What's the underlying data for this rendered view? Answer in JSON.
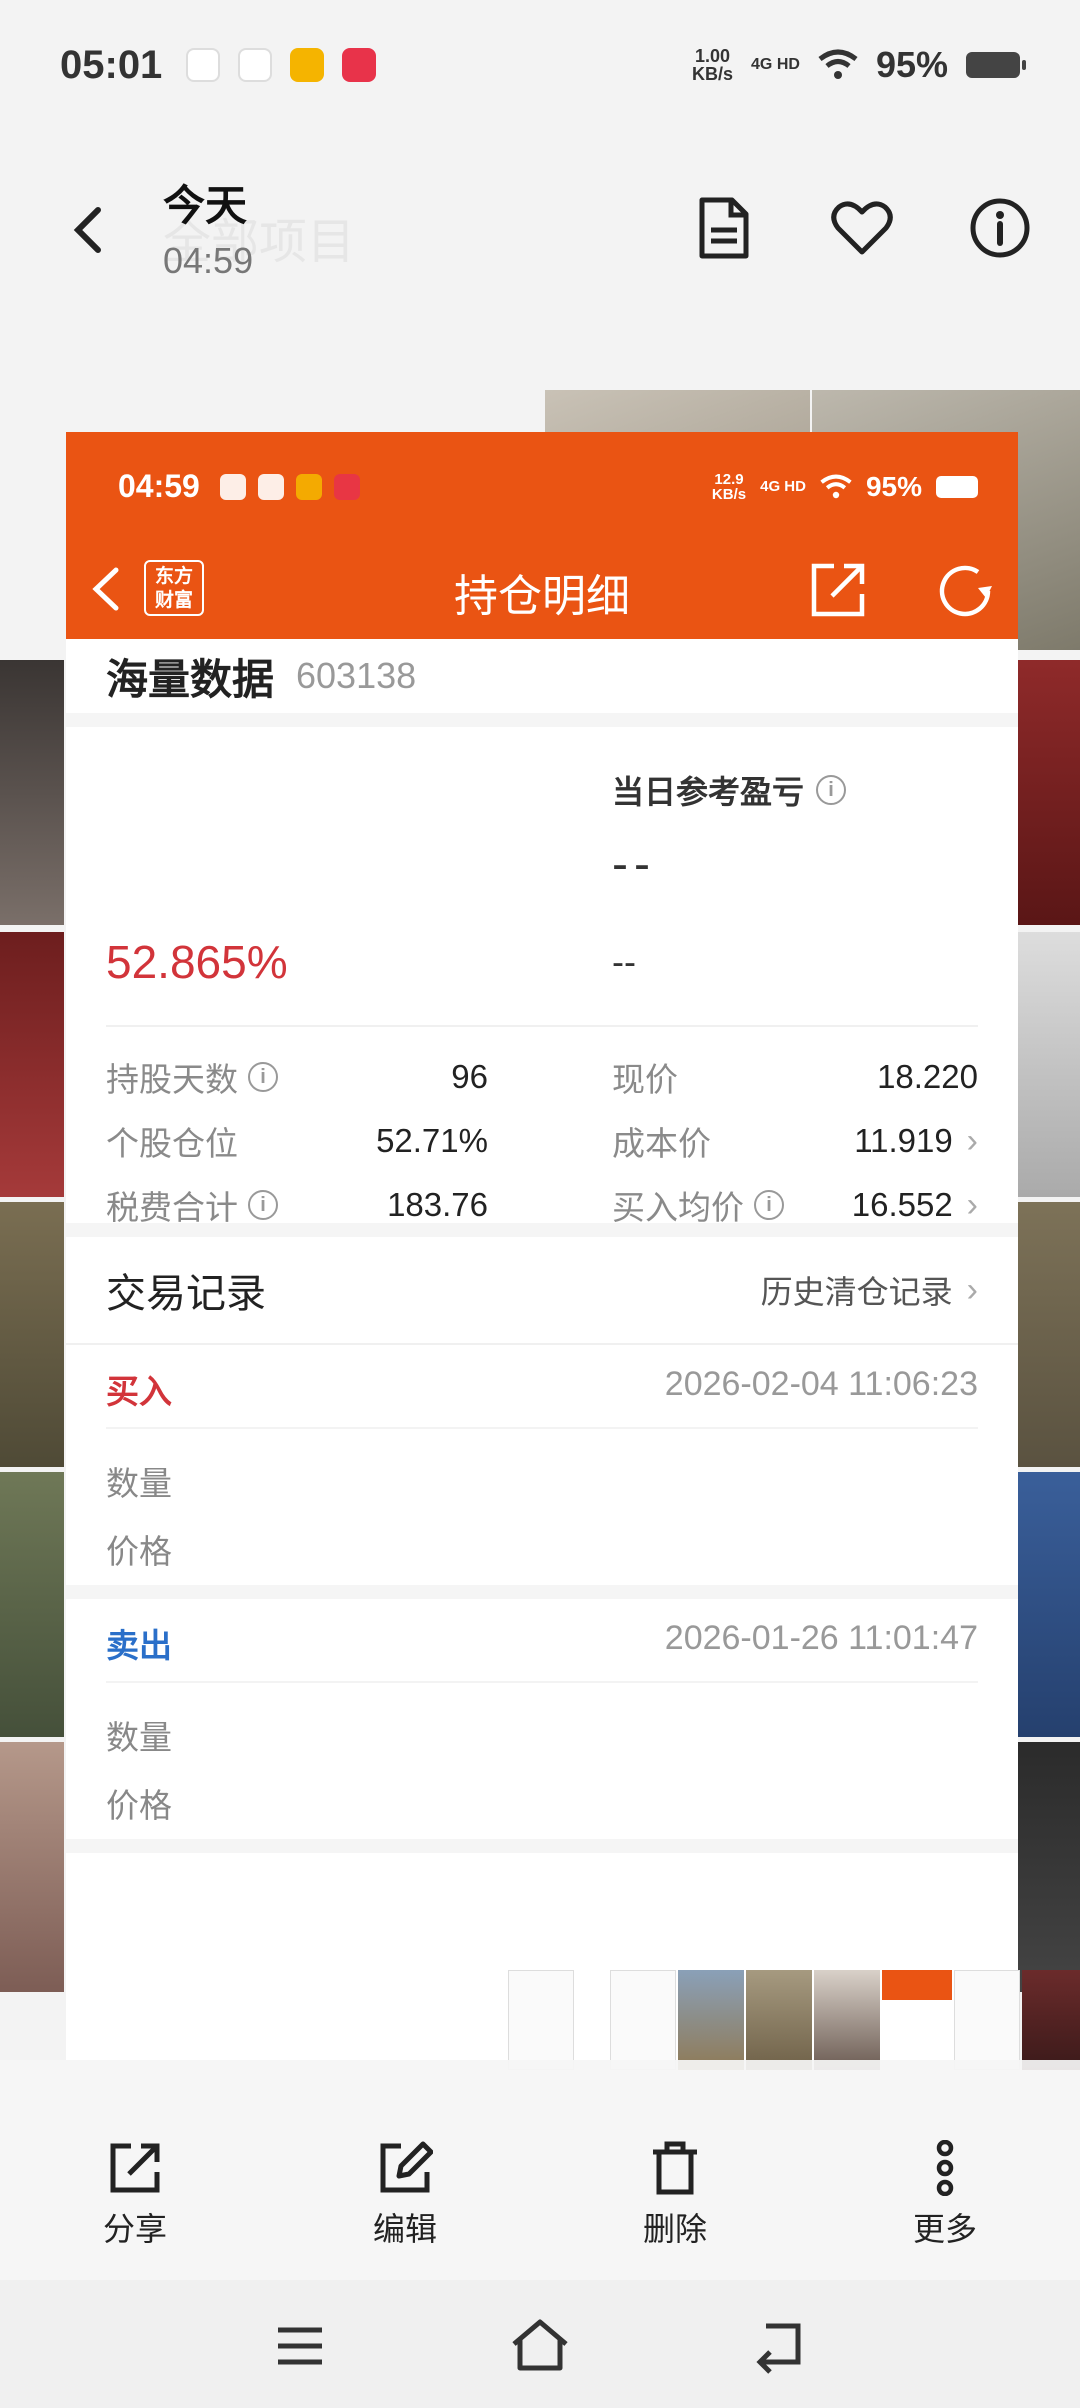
{
  "status_bar": {
    "time": "05:01",
    "net_speed_value": "1.00",
    "net_speed_unit": "KB/s",
    "net_type": "4G HD",
    "battery": "95%"
  },
  "gallery_header": {
    "title": "今天",
    "time": "04:59",
    "ghost_text": "全部项目"
  },
  "screenshot": {
    "status": {
      "time": "04:59",
      "net_speed_value": "12.9",
      "net_speed_unit": "KB/s",
      "net_type": "4G HD",
      "battery": "95%"
    },
    "nav": {
      "logo_line1": "东方",
      "logo_line2": "财富",
      "title": "持仓明细"
    },
    "stock": {
      "name": "海量数据",
      "code": "603138"
    },
    "pnl": {
      "label": "当日参考盈亏",
      "value": "--",
      "pct": "52.865%",
      "sub_value": "--"
    },
    "stats": {
      "hold_days_label": "持股天数",
      "hold_days_value": "96",
      "position_label": "个股仓位",
      "position_value": "52.71%",
      "fees_label": "税费合计",
      "fees_value": "183.76",
      "price_label": "现价",
      "price_value": "18.220",
      "cost_label": "成本价",
      "cost_value": "11.919",
      "avg_buy_label": "买入均价",
      "avg_buy_value": "16.552"
    },
    "records": {
      "title": "交易记录",
      "history_link": "历史清仓记录",
      "items": [
        {
          "type": "买入",
          "date": "2026-02-04 11:06:23",
          "qty_label": "数量",
          "price_label": "价格"
        },
        {
          "type": "卖出",
          "date": "2026-01-26 11:01:47",
          "qty_label": "数量",
          "price_label": "价格"
        }
      ]
    }
  },
  "bottom_bar": {
    "share": "分享",
    "edit": "编辑",
    "delete": "删除",
    "more": "更多"
  },
  "colors": {
    "brand_orange": "#ea5413",
    "profit_red": "#d2343a",
    "sell_blue": "#2a6fc9"
  }
}
